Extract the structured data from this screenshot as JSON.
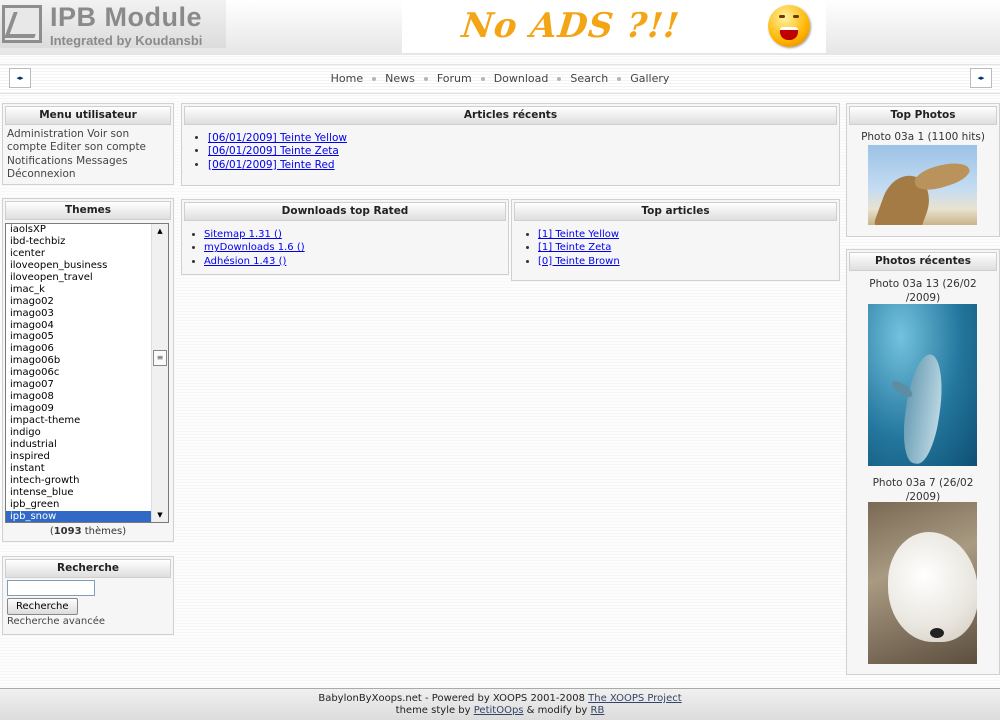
{
  "header": {
    "logo_title": "IPB Module",
    "logo_subtitle": "Integrated by Koudansbi",
    "banner_text": "No ADS ?!!"
  },
  "nav": {
    "left_arrow": "◂▸",
    "right_arrow": "◂▸",
    "items": [
      "Home",
      "News",
      "Forum",
      "Download",
      "Search",
      "Gallery"
    ]
  },
  "user_menu": {
    "title": "Menu utilisateur",
    "links": [
      "Administration",
      "Voir son compte",
      "Editer son compte",
      "Notifications",
      "Messages",
      "Déconnexion"
    ]
  },
  "themes": {
    "title": "Themes",
    "options": [
      "iaolsXP",
      "ibd-techbiz",
      "icenter",
      "iloveopen_business",
      "iloveopen_travel",
      "imac_k",
      "imago02",
      "imago03",
      "imago04",
      "imago05",
      "imago06",
      "imago06b",
      "imago06c",
      "imago07",
      "imago08",
      "imago09",
      "impact-theme",
      "indigo",
      "industrial",
      "inspired",
      "instant",
      "intech-growth",
      "intense_blue",
      "ipb_green",
      "ipb_snow"
    ],
    "selected": "ipb_snow",
    "count": "1093",
    "count_open": "(",
    "count_suffix": " thèmes)"
  },
  "search": {
    "title": "Recherche",
    "input_value": "",
    "button_label": "Recherche",
    "advanced_link": "Recherche avancée"
  },
  "recent_articles": {
    "title": "Articles récents",
    "items": [
      "[06/01/2009] Teinte Yellow",
      "[06/01/2009] Teinte Zeta",
      "[06/01/2009] Teinte Red"
    ]
  },
  "downloads": {
    "title": "Downloads top Rated",
    "items": [
      "Sitemap 1.31 ()",
      "myDownloads 1.6 ()",
      "Adhésion 1.43 ()"
    ]
  },
  "top_articles": {
    "title": "Top articles",
    "items": [
      "[1] Teinte Yellow",
      "[1] Teinte Zeta",
      "[0] Teinte Brown"
    ]
  },
  "top_photos": {
    "title": "Top Photos",
    "caption": "Photo 03a 1 (1100 hits)"
  },
  "recent_photos": {
    "title": "Photos récentes",
    "photos": [
      {
        "caption_line1": "Photo 03a 13 (26/02",
        "caption_line2": "/2009)"
      },
      {
        "caption_line1": "Photo 03a 7 (26/02",
        "caption_line2": "/2009)"
      }
    ]
  },
  "footer": {
    "line1_a": "BabylonByXoops.net - Powered by XOOPS 2001-2008 ",
    "line1_link": "The XOOPS Project",
    "line2_a": "theme style by ",
    "line2_link1": "PetitOOps",
    "line2_b": " & modify by ",
    "line2_link2": "RB"
  }
}
